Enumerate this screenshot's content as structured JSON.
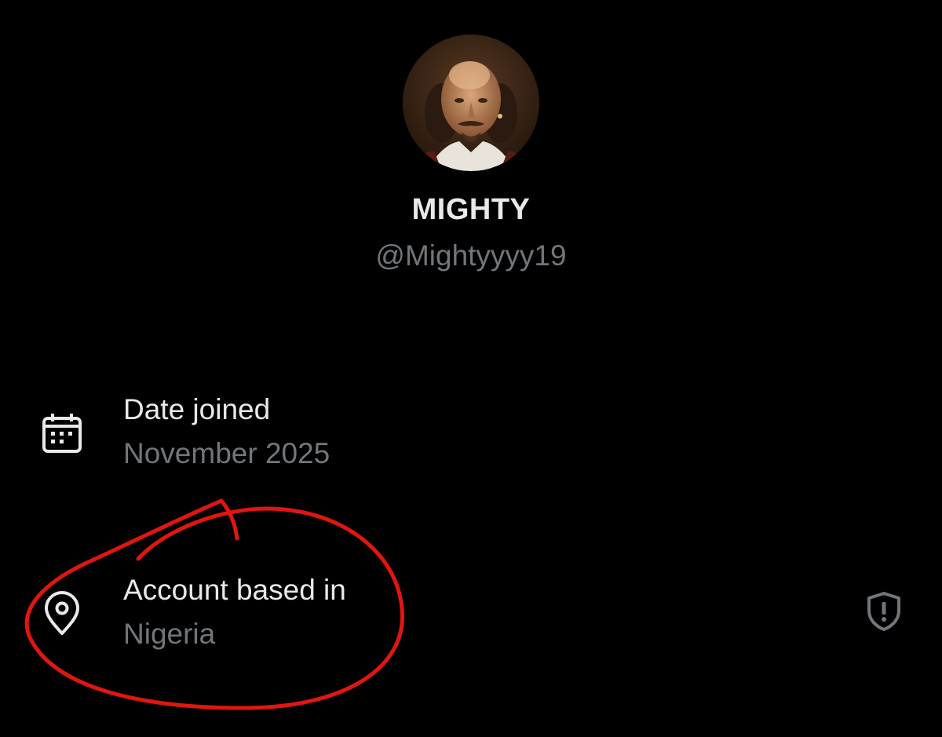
{
  "profile": {
    "display_name": "MIGHTY",
    "handle": "@Mightyyyy19",
    "avatar_icon": "avatar-portrait"
  },
  "about": {
    "rows": [
      {
        "icon": "calendar-icon",
        "title": "Date joined",
        "value": "November 2025"
      },
      {
        "icon": "location-pin-icon",
        "title": "Account based in",
        "value": "Nigeria"
      }
    ],
    "privacy_icon": "shield-alert-icon"
  },
  "colors": {
    "background": "#000000",
    "primary_text": "#e7e9ea",
    "secondary_text": "#71767b",
    "annotation_red": "#e0160f"
  }
}
